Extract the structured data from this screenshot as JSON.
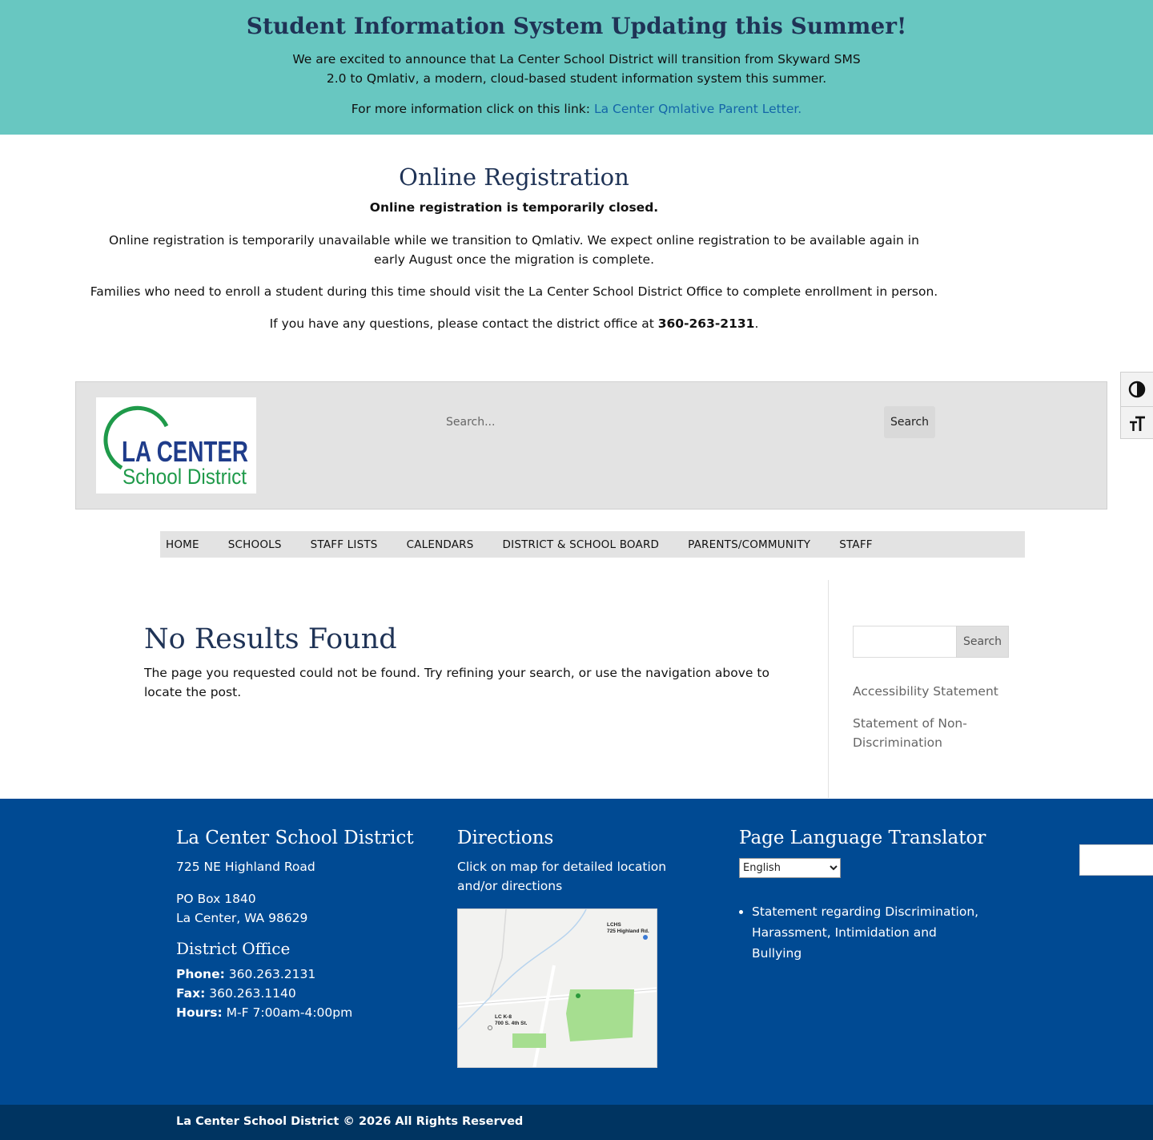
{
  "banner": {
    "title": "Student Information System Updating this Summer!",
    "announcement": "We are excited to announce that La Center School District will transition from Skyward SMS 2.0 to Qmlativ, a modern, cloud-based student information system this summer.",
    "more_info_prefix": "For more information click on this link: ",
    "more_info_link": "La Center Qmlative Parent Letter."
  },
  "registration": {
    "title": "Online Registration",
    "closed_notice": "Online registration is temporarily closed.",
    "paragraph1": "Online registration is temporarily unavailable while we transition to Qmlativ. We expect online registration to be available again in early August once the migration is complete.",
    "paragraph2": "Families who need to enroll a student during this time should visit the La Center School District Office to complete enrollment in person.",
    "contact_prefix": "If you have any questions, please contact the district office at ",
    "contact_phone": "360-263-2131",
    "contact_suffix": "."
  },
  "header": {
    "logo_line1": "LA CENTER",
    "logo_line2": "School District",
    "search_placeholder": "Search...",
    "search_button": "Search"
  },
  "nav": {
    "items": [
      "HOME",
      "SCHOOLS",
      "STAFF LISTS",
      "CALENDARS",
      "DISTRICT & SCHOOL BOARD",
      "PARENTS/COMMUNITY",
      "STAFF"
    ]
  },
  "main": {
    "title": "No Results Found",
    "text": "The page you requested could not be found. Try refining your search, or use the navigation above to locate the post."
  },
  "sidebar": {
    "search_button": "Search",
    "links": [
      "Accessibility Statement",
      "Statement of Non-Discrimination"
    ]
  },
  "footer": {
    "district": {
      "title": "La Center School District",
      "address": "725 NE Highland Road",
      "po_box": "PO Box 1840",
      "city": "La Center, WA 98629"
    },
    "office": {
      "title": "District Office",
      "phone_label": "Phone:",
      "phone": "360.263.2131",
      "fax_label": "Fax:",
      "fax": "360.263.1140",
      "hours_label": "Hours:",
      "hours": "M-F 7:00am-4:00pm"
    },
    "directions": {
      "title": "Directions",
      "text": "Click on map for detailed location and/or directions",
      "map_label_lchs": "LCHS",
      "map_label_lchs_addr": "725 Highland Rd.",
      "map_label_lck8": "LC K-8",
      "map_label_lck8_addr": "700 S. 4th St."
    },
    "translator": {
      "title": "Page Language Translator",
      "selected_language": "English",
      "links": [
        "Statement regarding Discrimination, Harassment, Intimidation and Bullying"
      ]
    },
    "copyright": "La Center School District © 2026 All Rights Reserved"
  },
  "colors": {
    "banner": "#68c7c1",
    "heading": "#1f3356",
    "footer": "#004a93",
    "bottom_bar": "#003461",
    "logo_green": "#1f9a4a",
    "logo_blue": "#1f3c8a"
  },
  "icons": {
    "contrast": "contrast-icon",
    "font_size": "font-size-icon"
  }
}
